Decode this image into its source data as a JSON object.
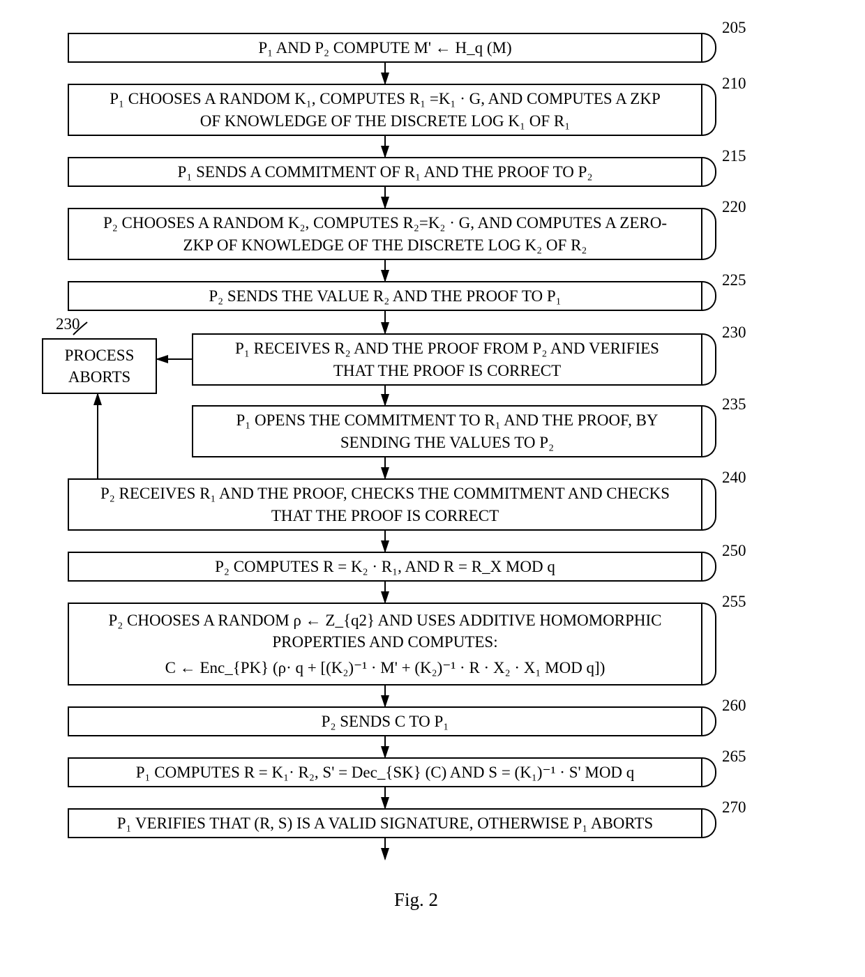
{
  "steps": {
    "s205": "P₁ AND P₂ COMPUTE M' ← H_q (M)",
    "s210_l1": "P₁ CHOOSES A RANDOM K₁, COMPUTES R₁ =K₁ · G, AND COMPUTES A ZKP",
    "s210_l2": "OF KNOWLEDGE OF THE DISCRETE LOG K₁ OF R₁",
    "s215": "P₁ SENDS A COMMITMENT OF R₁ AND THE PROOF TO P₂",
    "s220_l1": "P₂ CHOOSES A RANDOM K₂, COMPUTES R₂=K₂ · G, AND COMPUTES A ZERO-",
    "s220_l2": "ZKP OF KNOWLEDGE OF THE DISCRETE LOG K₂ OF R₂",
    "s225": "P₂ SENDS THE VALUE R₂ AND THE PROOF TO P₁",
    "abort_l1": "PROCESS",
    "abort_l2": "ABORTS",
    "s230_l1": "P₁ RECEIVES R₂ AND THE PROOF FROM P₂ AND VERIFIES",
    "s230_l2": "THAT THE PROOF IS CORRECT",
    "s235_l1": "P₁ OPENS THE COMMITMENT TO R₁ AND THE PROOF, BY",
    "s235_l2": "SENDING THE VALUES TO P₂",
    "s240_l1": "P₂ RECEIVES R₁ AND THE PROOF, CHECKS THE COMMITMENT AND CHECKS",
    "s240_l2": "THAT THE PROOF IS CORRECT",
    "s250": "P₂ COMPUTES R = K₂ · R₁, AND R = R_X MOD q",
    "s255_l1": "P₂ CHOOSES A RANDOM ρ ← Z_{q2} AND USES ADDITIVE HOMOMORPHIC",
    "s255_l2": "PROPERTIES AND COMPUTES:",
    "s255_l3": "C ← Enc_{PK} (ρ· q + [(K₂)⁻¹ · M' + (K₂)⁻¹ · R · X₂ · X₁ MOD q])",
    "s260": "P₂ SENDS C TO P₁",
    "s265": "P₁ COMPUTES R = K₁· R₂, S' = Dec_{SK} (C) AND S = (K₁)⁻¹ · S' MOD q",
    "s270": "P₁ VERIFIES THAT (R, S) IS A VALID SIGNATURE, OTHERWISE P₁ ABORTS"
  },
  "labels": {
    "l205": "205",
    "l210": "210",
    "l215": "215",
    "l220": "220",
    "l225": "225",
    "l230a": "230",
    "l230b": "230",
    "l235": "235",
    "l240": "240",
    "l250": "250",
    "l255": "255",
    "l260": "260",
    "l265": "265",
    "l270": "270"
  },
  "figure_caption": "Fig. 2"
}
